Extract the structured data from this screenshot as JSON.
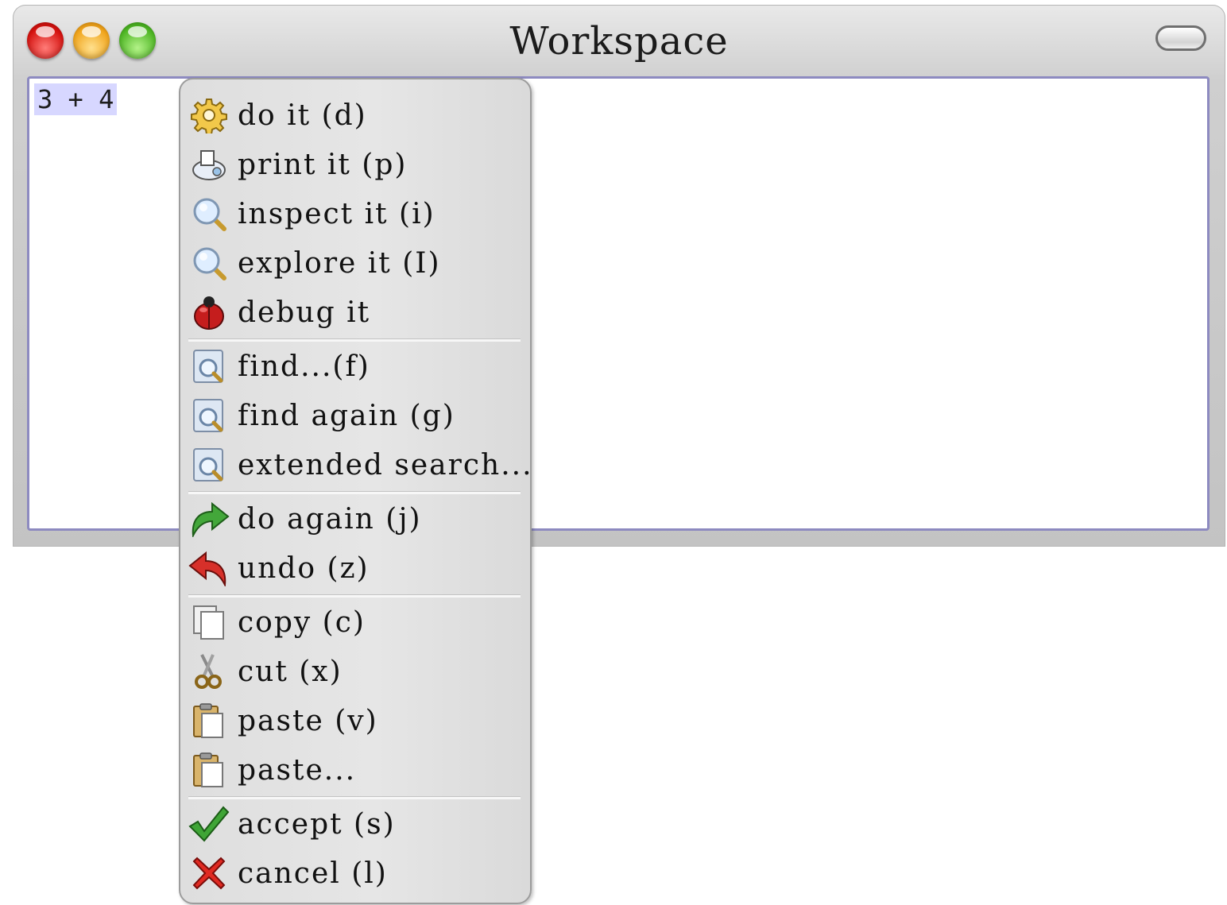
{
  "window": {
    "title": "Workspace",
    "code": "3 + 4"
  },
  "menu": {
    "items": [
      {
        "label": "do it (d)",
        "icon": "gear-icon"
      },
      {
        "label": "print it (p)",
        "icon": "print-icon"
      },
      {
        "label": "inspect it (i)",
        "icon": "magnifier-icon"
      },
      {
        "label": "explore it (I)",
        "icon": "magnifier-icon"
      },
      {
        "label": "debug it",
        "icon": "ladybug-icon"
      },
      {
        "label": "find...(f)",
        "icon": "find-icon"
      },
      {
        "label": "find again (g)",
        "icon": "find-icon"
      },
      {
        "label": "extended search...",
        "icon": "find-icon"
      },
      {
        "label": "do again (j)",
        "icon": "redo-arrow-icon"
      },
      {
        "label": "undo (z)",
        "icon": "undo-arrow-icon"
      },
      {
        "label": "copy (c)",
        "icon": "copy-icon"
      },
      {
        "label": "cut (x)",
        "icon": "scissors-icon"
      },
      {
        "label": "paste (v)",
        "icon": "paste-icon"
      },
      {
        "label": "paste...",
        "icon": "paste-icon"
      },
      {
        "label": "accept (s)",
        "icon": "checkmark-icon"
      },
      {
        "label": "cancel (l)",
        "icon": "red-x-icon"
      }
    ]
  },
  "colors": {
    "selection": "#d7d7ff",
    "pane_border": "#8d8ac0",
    "menu_bg": "#e2e2e2"
  }
}
